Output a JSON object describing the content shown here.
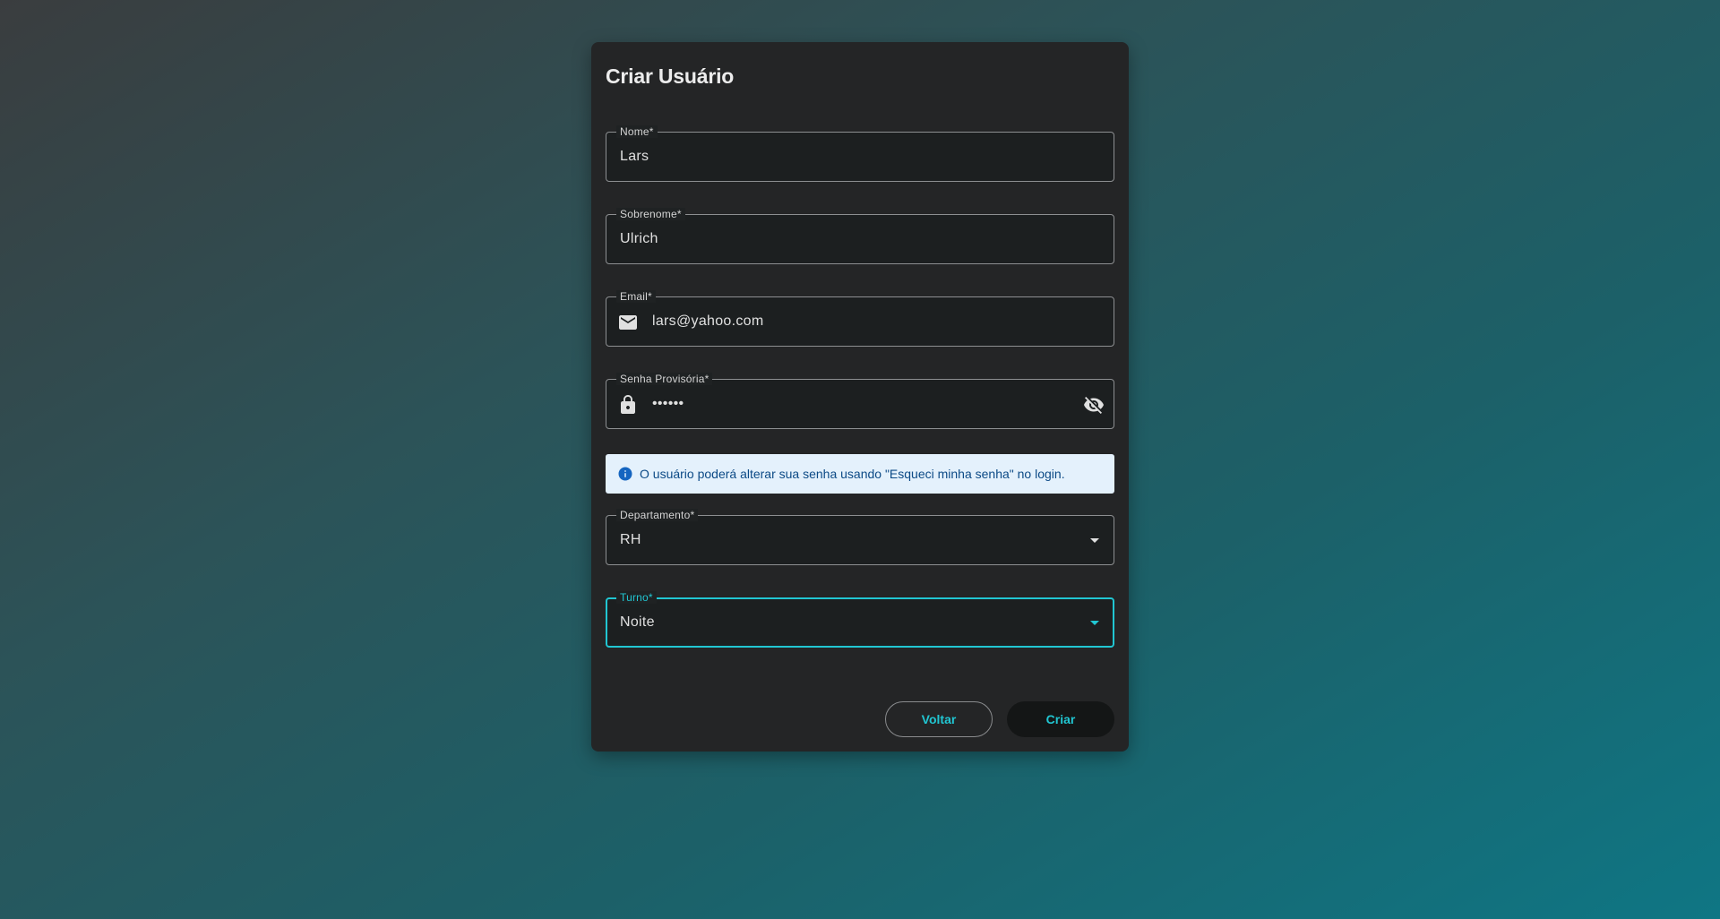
{
  "form": {
    "title": "Criar Usuário",
    "fields": {
      "nome": {
        "label": "Nome*",
        "value": "Lars"
      },
      "sobrenome": {
        "label": "Sobrenome*",
        "value": "Ulrich"
      },
      "email": {
        "label": "Email*",
        "value": "lars@yahoo.com",
        "icon": "email-icon"
      },
      "senha": {
        "label": "Senha Provisória*",
        "value": "••••••",
        "icon": "lock-icon",
        "toggle_icon": "visibility-off-icon"
      },
      "departamento": {
        "label": "Departamento*",
        "value": "RH"
      },
      "turno": {
        "label": "Turno*",
        "value": "Noite",
        "focused": true
      }
    },
    "info_alert": {
      "icon": "info-icon",
      "text": "O usuário poderá alterar sua senha usando \"Esqueci minha senha\" no login."
    },
    "buttons": {
      "back": "Voltar",
      "create": "Criar"
    }
  },
  "colors": {
    "accent": "#21c6d2",
    "card_background": "#242526",
    "alert_background": "#e4f1fc",
    "alert_text": "#0c4a86"
  }
}
